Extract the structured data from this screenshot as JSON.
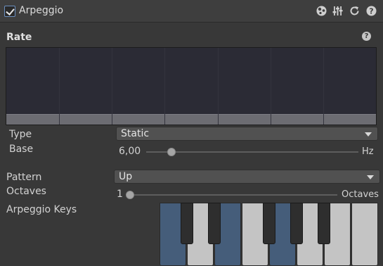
{
  "header": {
    "title": "Arpeggio",
    "enabled": true,
    "icons": [
      "presets-icon",
      "settings-sliders-icon",
      "reset-icon",
      "help-icon"
    ]
  },
  "rate": {
    "title": "Rate",
    "help_glyph": "?",
    "graph_columns": 7
  },
  "type": {
    "label": "Type",
    "value": "Static"
  },
  "base": {
    "label": "Base",
    "value": "6,00",
    "unit": "Hz",
    "fraction": 0.12
  },
  "pattern": {
    "label": "Pattern",
    "value": "Up"
  },
  "octaves": {
    "label": "Octaves",
    "value": "1",
    "unit": "Octaves",
    "fraction": 0.0
  },
  "arpeggio_keys": {
    "label": "Arpeggio Keys",
    "white_keys": [
      {
        "note": "C",
        "on": true
      },
      {
        "note": "D",
        "on": false
      },
      {
        "note": "E",
        "on": true
      },
      {
        "note": "F",
        "on": false
      },
      {
        "note": "G",
        "on": true
      },
      {
        "note": "A",
        "on": false
      },
      {
        "note": "B",
        "on": false
      },
      {
        "note": "C2",
        "on": false
      }
    ],
    "black_keys": [
      {
        "note": "C#",
        "on": false
      },
      {
        "note": "D#",
        "on": false
      },
      {
        "note": "F#",
        "on": false
      },
      {
        "note": "G#",
        "on": false
      },
      {
        "note": "A#",
        "on": false
      }
    ],
    "colors": {
      "active": "#455d7a",
      "white": "#c4c4c4",
      "black": "#2e2e2e"
    }
  },
  "colors": {
    "background": "#383838",
    "header": "#3e3e3e",
    "graph_bg": "#2b2b35",
    "accent": "#6b8fbf"
  }
}
